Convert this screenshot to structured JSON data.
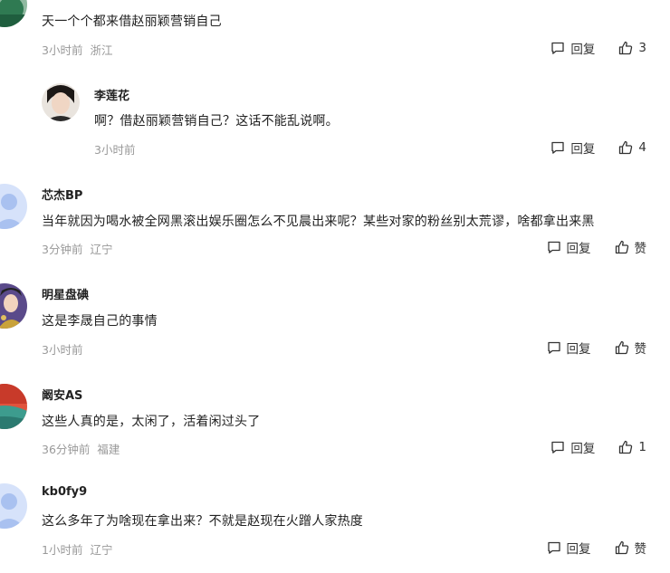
{
  "actions": {
    "reply_label": "回复",
    "like_icon": "thumbs-up-icon",
    "reply_icon": "comment-bubble-icon"
  },
  "comments": [
    {
      "username": "",
      "text": "天一个个都来借赵丽颖营销自己",
      "time": "3小时前",
      "location": "浙江",
      "likes": "3",
      "avatar_color": "#2f7a52"
    },
    {
      "username": "李莲花",
      "text": "啊？借赵丽颖营销自己？这话不能乱说啊。",
      "time": "3小时前",
      "location": "",
      "likes": "4",
      "avatar_color": "#3a2f2c"
    },
    {
      "username": "芯杰BP",
      "text": "当年就因为喝水被全网黑滚出娱乐圈怎么不见晨出来呢？某些对家的粉丝别太荒谬，啥都拿出来黑",
      "time": "3分钟前",
      "location": "辽宁",
      "likes": "赞",
      "avatar_color": "#c6d6f5"
    },
    {
      "username": "明星盘碘",
      "text": "这是李晟自己的事情",
      "time": "3小时前",
      "location": "",
      "likes": "赞",
      "avatar_color": "#3b2a6e"
    },
    {
      "username": "阚安AS",
      "text": "这些人真的是，太闲了，活着闲过头了",
      "time": "36分钟前",
      "location": "福建",
      "likes": "1",
      "avatar_color": "#d4402e"
    },
    {
      "username": "kb0fy9",
      "text": "这么多年了为啥现在拿出来？不就是赵现在火蹭人家热度",
      "time": "1小时前",
      "location": "辽宁",
      "likes": "赞",
      "avatar_color": "#c6d6f5"
    }
  ]
}
